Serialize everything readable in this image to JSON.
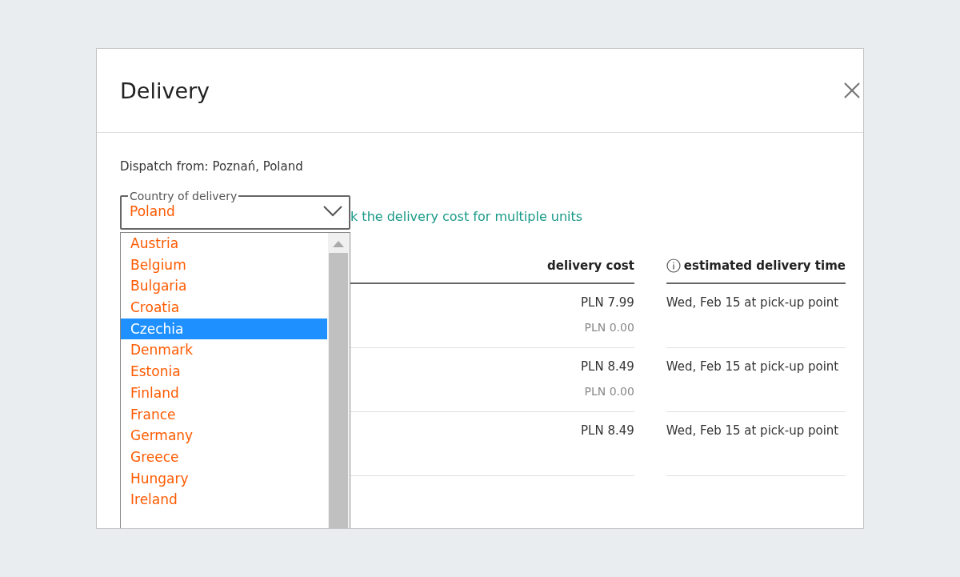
{
  "dialog": {
    "title": "Delivery"
  },
  "dispatch": "Dispatch from: Poznań, Poland",
  "country_select": {
    "label": "Country of delivery",
    "value": "Poland",
    "expanded": true,
    "options": [
      {
        "label": "Austria",
        "selected": false
      },
      {
        "label": "Belgium",
        "selected": false
      },
      {
        "label": "Bulgaria",
        "selected": false
      },
      {
        "label": "Croatia",
        "selected": false
      },
      {
        "label": "Czechia",
        "selected": true
      },
      {
        "label": "Denmark",
        "selected": false
      },
      {
        "label": "Estonia",
        "selected": false
      },
      {
        "label": "Finland",
        "selected": false
      },
      {
        "label": "France",
        "selected": false
      },
      {
        "label": "Germany",
        "selected": false
      },
      {
        "label": "Greece",
        "selected": false
      },
      {
        "label": "Hungary",
        "selected": false
      },
      {
        "label": "Ireland",
        "selected": false
      }
    ]
  },
  "link": "k the delivery cost for multiple units",
  "table": {
    "columns": [
      "delivery cost",
      "estimated delivery time"
    ],
    "rows": [
      {
        "cost": "PLN 7.99",
        "extra_cost": "PLN 0.00",
        "time": "Wed, Feb 15 at pick-up point"
      },
      {
        "cost": "PLN 8.49",
        "extra_cost": "PLN 0.00",
        "time": "Wed, Feb 15 at pick-up point"
      },
      {
        "cost": "PLN 8.49",
        "time": "Wed, Feb 15 at pick-up point"
      }
    ]
  }
}
